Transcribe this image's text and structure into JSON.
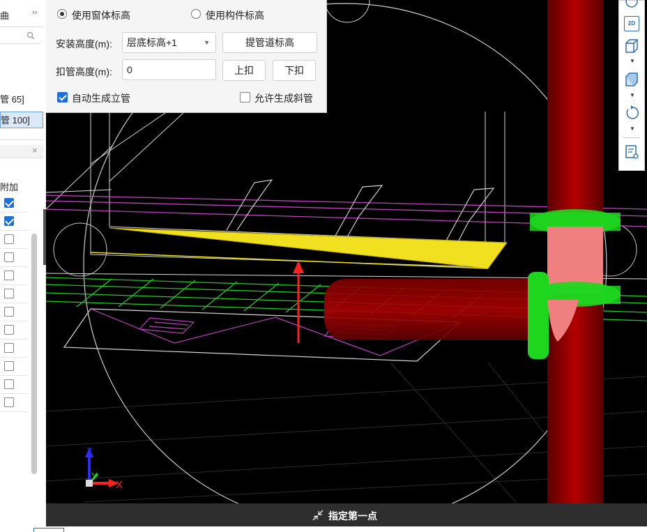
{
  "left_panel": {
    "top_label": "曲",
    "expand_glyph": "››",
    "items": [
      {
        "label": "管 65]",
        "selected": false
      },
      {
        "label": "管 100]",
        "selected": true
      }
    ],
    "subpanel": {
      "close_glyph": "×",
      "column_header": "附加",
      "checkboxes": [
        true,
        true,
        false,
        false,
        false,
        false,
        false,
        false,
        false,
        false,
        false,
        false
      ]
    }
  },
  "dialog": {
    "radio_window": {
      "label": "使用窗体标高",
      "checked": true
    },
    "radio_component": {
      "label": "使用构件标高",
      "checked": false
    },
    "install_height_label": "安装高度(m):",
    "install_height_value": "层底标高+1",
    "extract_shaft_button": "提管道标高",
    "buckle_height_label": "扣管高度(m):",
    "buckle_height_value": "0",
    "up_button": "上扣",
    "down_button": "下扣",
    "auto_riser": {
      "label": "自动生成立管",
      "checked": true
    },
    "allow_slant": {
      "label": "允许生成斜管",
      "checked": false
    }
  },
  "toolbar": {
    "icons": [
      "2d-view-icon",
      "cube-view-icon",
      "cube-shaded-icon",
      "rotate-icon",
      "properties-icon"
    ],
    "label_2d": "2D"
  },
  "axis": {
    "x": "X",
    "y": "Y",
    "z": "Z"
  },
  "status": {
    "prompt": "指定第一点"
  },
  "colors": {
    "pipe_red": "#b30000",
    "fitting_green": "#1ed61e",
    "dialog_bg": "#f5f5f5",
    "accent_blue": "#1f6fd6"
  }
}
